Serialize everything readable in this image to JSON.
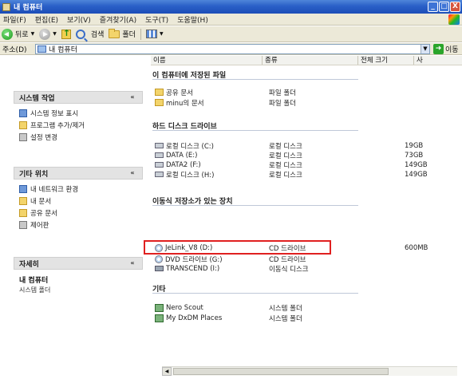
{
  "window": {
    "title": "내 컴퓨터",
    "controls": [
      "_",
      "□",
      "X"
    ]
  },
  "menu": [
    "파일(F)",
    "편집(E)",
    "보기(V)",
    "즐겨찾기(A)",
    "도구(T)",
    "도움말(H)"
  ],
  "toolbar": {
    "back_label": "뒤로",
    "search_label": "검색",
    "folders_label": "폴더"
  },
  "address": {
    "label": "주소(D)",
    "value": "내 컴퓨터",
    "go_label": "이동"
  },
  "left_pane": {
    "system_tasks": {
      "title": "시스템 작업",
      "items": [
        "시스템 정보 표시",
        "프로그램 추가/제거",
        "설정 변경"
      ]
    },
    "other_places": {
      "title": "기타 위치",
      "items": [
        "내 네트워크 환경",
        "내 문서",
        "공유 문서",
        "제어판"
      ]
    },
    "details": {
      "title": "자세히",
      "name": "내 컴퓨터",
      "sub": "시스템 폴더"
    }
  },
  "columns": [
    "이름",
    "종류",
    "전체 크기",
    "사"
  ],
  "groups": {
    "stored_files": {
      "title": "이 컴퓨터에 저장된 파일",
      "rows": [
        {
          "name": "공유 문서",
          "type": "파일 폴더",
          "size": ""
        },
        {
          "name": "minu의 문서",
          "type": "파일 폴더",
          "size": ""
        }
      ]
    },
    "hard_disks": {
      "title": "하드 디스크 드라이브",
      "rows": [
        {
          "name": "로컬 디스크 (C:)",
          "type": "로컬 디스크",
          "size": "19GB"
        },
        {
          "name": "DATA (E:)",
          "type": "로컬 디스크",
          "size": "73GB"
        },
        {
          "name": "DATA2 (F:)",
          "type": "로컬 디스크",
          "size": "149GB"
        },
        {
          "name": "로컬 디스크 (H:)",
          "type": "로컬 디스크",
          "size": "149GB"
        }
      ]
    },
    "removable": {
      "title": "이동식 저장소가 있는 장치",
      "rows": [
        {
          "name": "JeLink_V8 (D:)",
          "type": "CD 드라이브",
          "size": "600MB"
        },
        {
          "name": "DVD 드라이브 (G:)",
          "type": "CD 드라이브",
          "size": ""
        },
        {
          "name": "TRANSCEND (I:)",
          "type": "이동식 디스크",
          "size": ""
        }
      ]
    },
    "other": {
      "title": "기타",
      "rows": [
        {
          "name": "Nero Scout",
          "type": "시스템 폴더",
          "size": ""
        },
        {
          "name": "My DxDM Places",
          "type": "시스템 폴더",
          "size": ""
        }
      ]
    }
  },
  "colors": {
    "title_bar": "#2a5fc7",
    "highlight_box": "#e02020"
  }
}
